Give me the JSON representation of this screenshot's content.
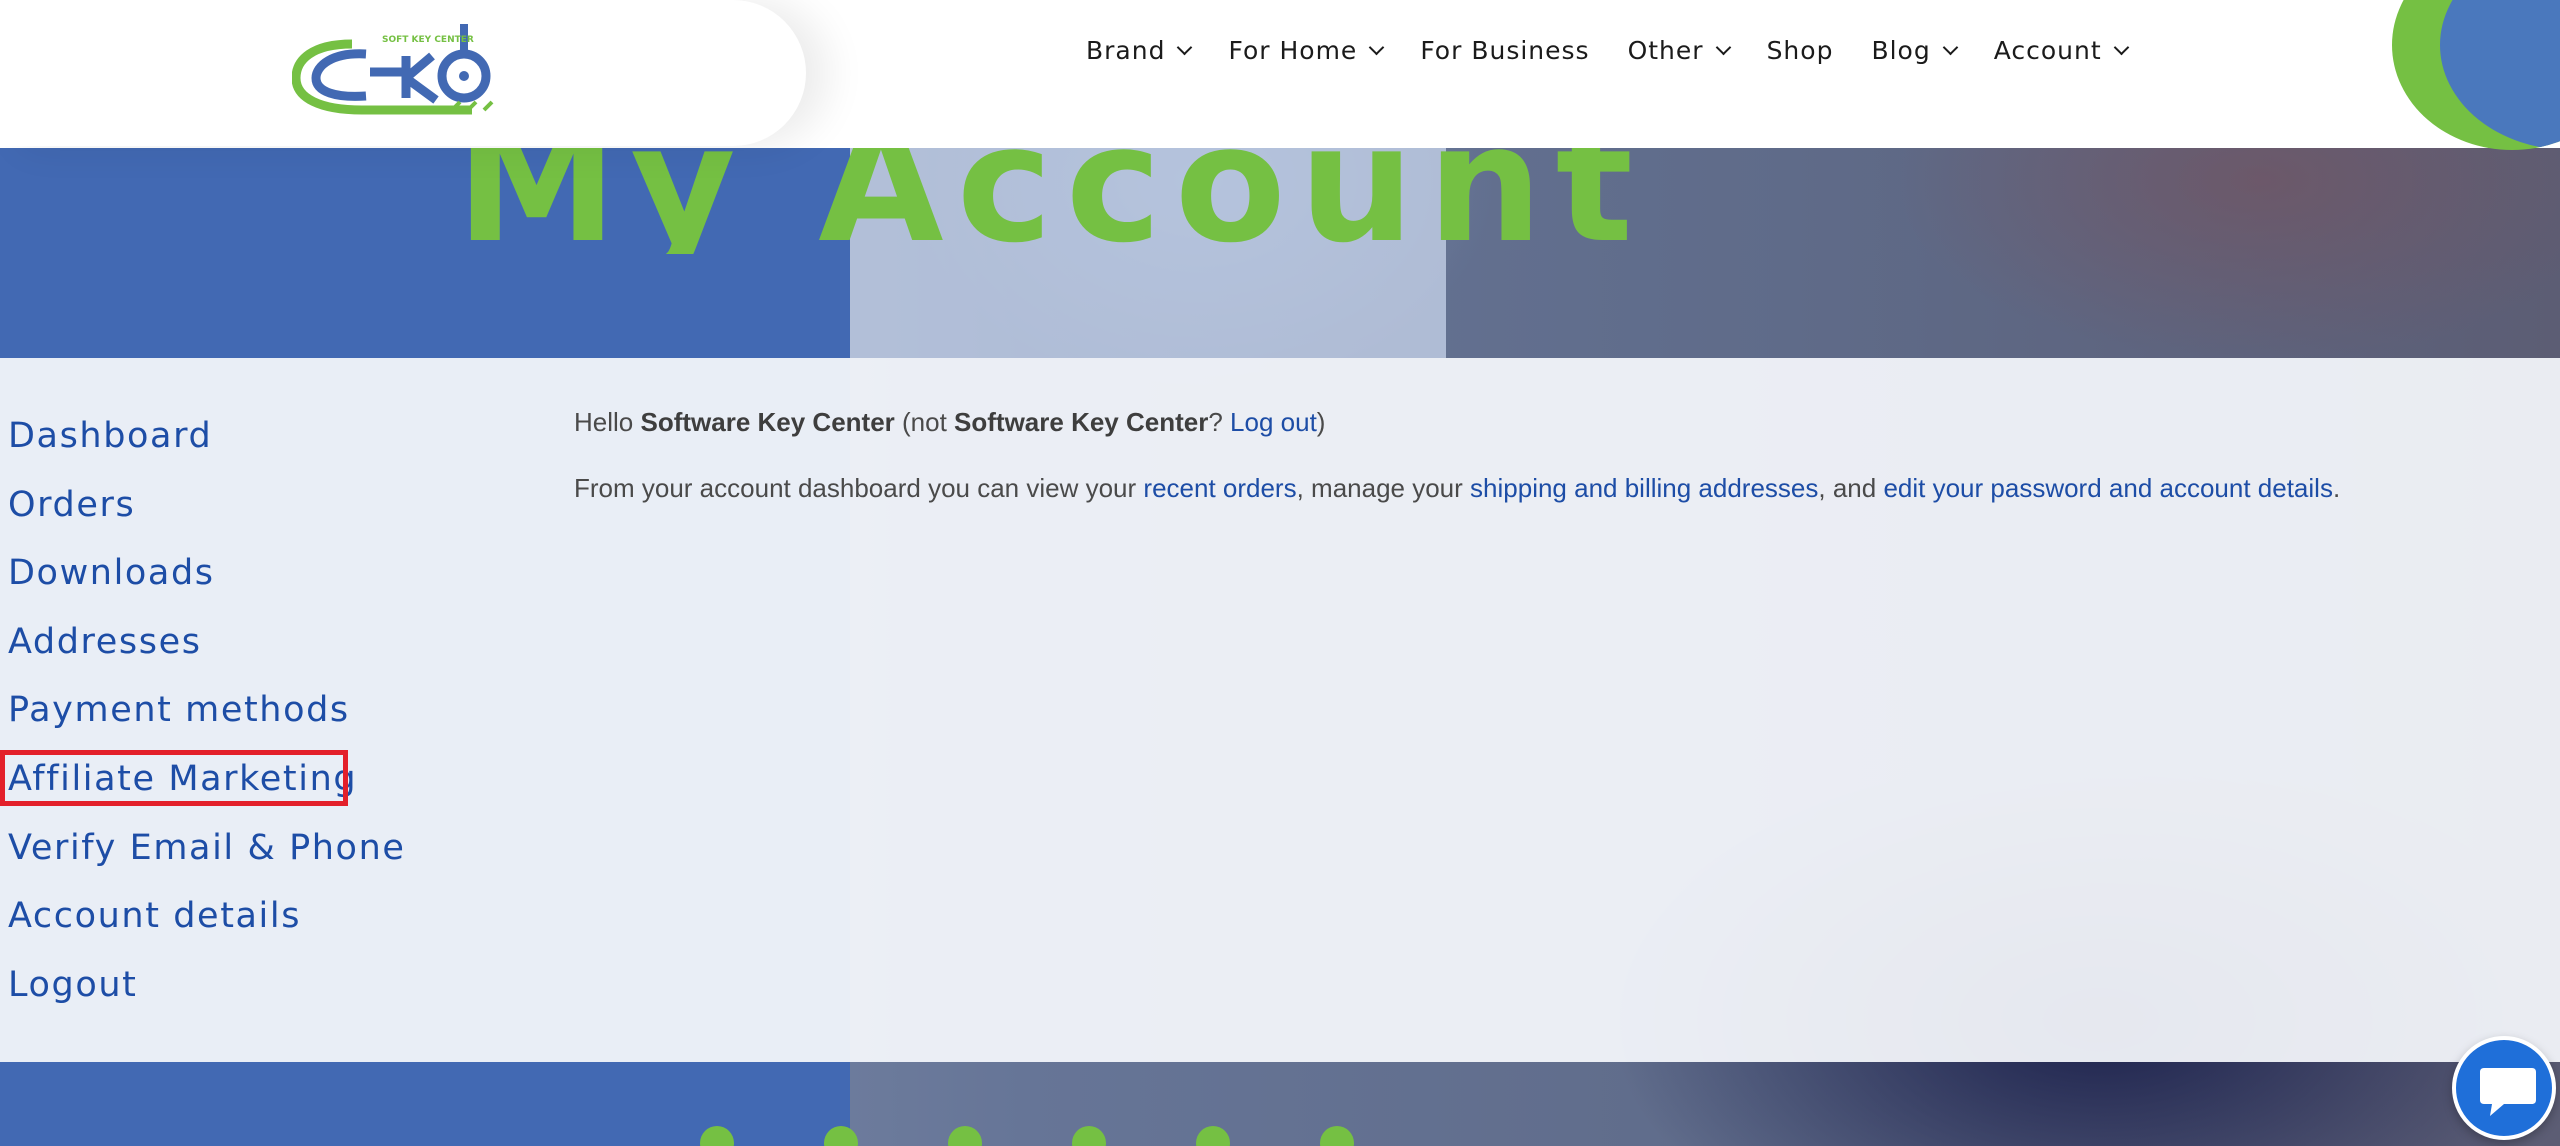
{
  "brand": {
    "logo_text": "SOFT KEY CENTER",
    "colors": {
      "green": "#75c043",
      "blue": "#1d4da6",
      "band_blue": "#4269b3",
      "highlight": "#e3202a"
    }
  },
  "nav": {
    "items": [
      {
        "label": "Brand",
        "dropdown": true
      },
      {
        "label": "For Home",
        "dropdown": true
      },
      {
        "label": "For Business",
        "dropdown": false
      },
      {
        "label": "Other",
        "dropdown": true
      },
      {
        "label": "Shop",
        "dropdown": false
      },
      {
        "label": "Blog",
        "dropdown": true
      },
      {
        "label": "Account",
        "dropdown": true
      }
    ]
  },
  "page": {
    "title": "My Account"
  },
  "account_nav": {
    "items": [
      {
        "label": "Dashboard"
      },
      {
        "label": "Orders"
      },
      {
        "label": "Downloads"
      },
      {
        "label": "Addresses"
      },
      {
        "label": "Payment methods"
      },
      {
        "label": "Affiliate Marketing",
        "highlighted": true
      },
      {
        "label": "Verify Email & Phone"
      },
      {
        "label": "Account details"
      },
      {
        "label": "Logout"
      }
    ]
  },
  "dashboard": {
    "hello": "Hello ",
    "username": "Software Key Center",
    "not_prefix": " (not ",
    "not_name": "Software Key Center",
    "not_suffix": "? ",
    "logout_link": "Log out",
    "close_paren": ")",
    "intro": "From your account dashboard you can view your ",
    "recent_orders": "recent orders",
    "manage": ", manage your ",
    "addresses_link": "shipping and billing addresses",
    "and": ", and ",
    "edit_link": "edit your password and account details",
    "period": "."
  },
  "chat": {
    "icon": "chat-bubble-icon"
  }
}
